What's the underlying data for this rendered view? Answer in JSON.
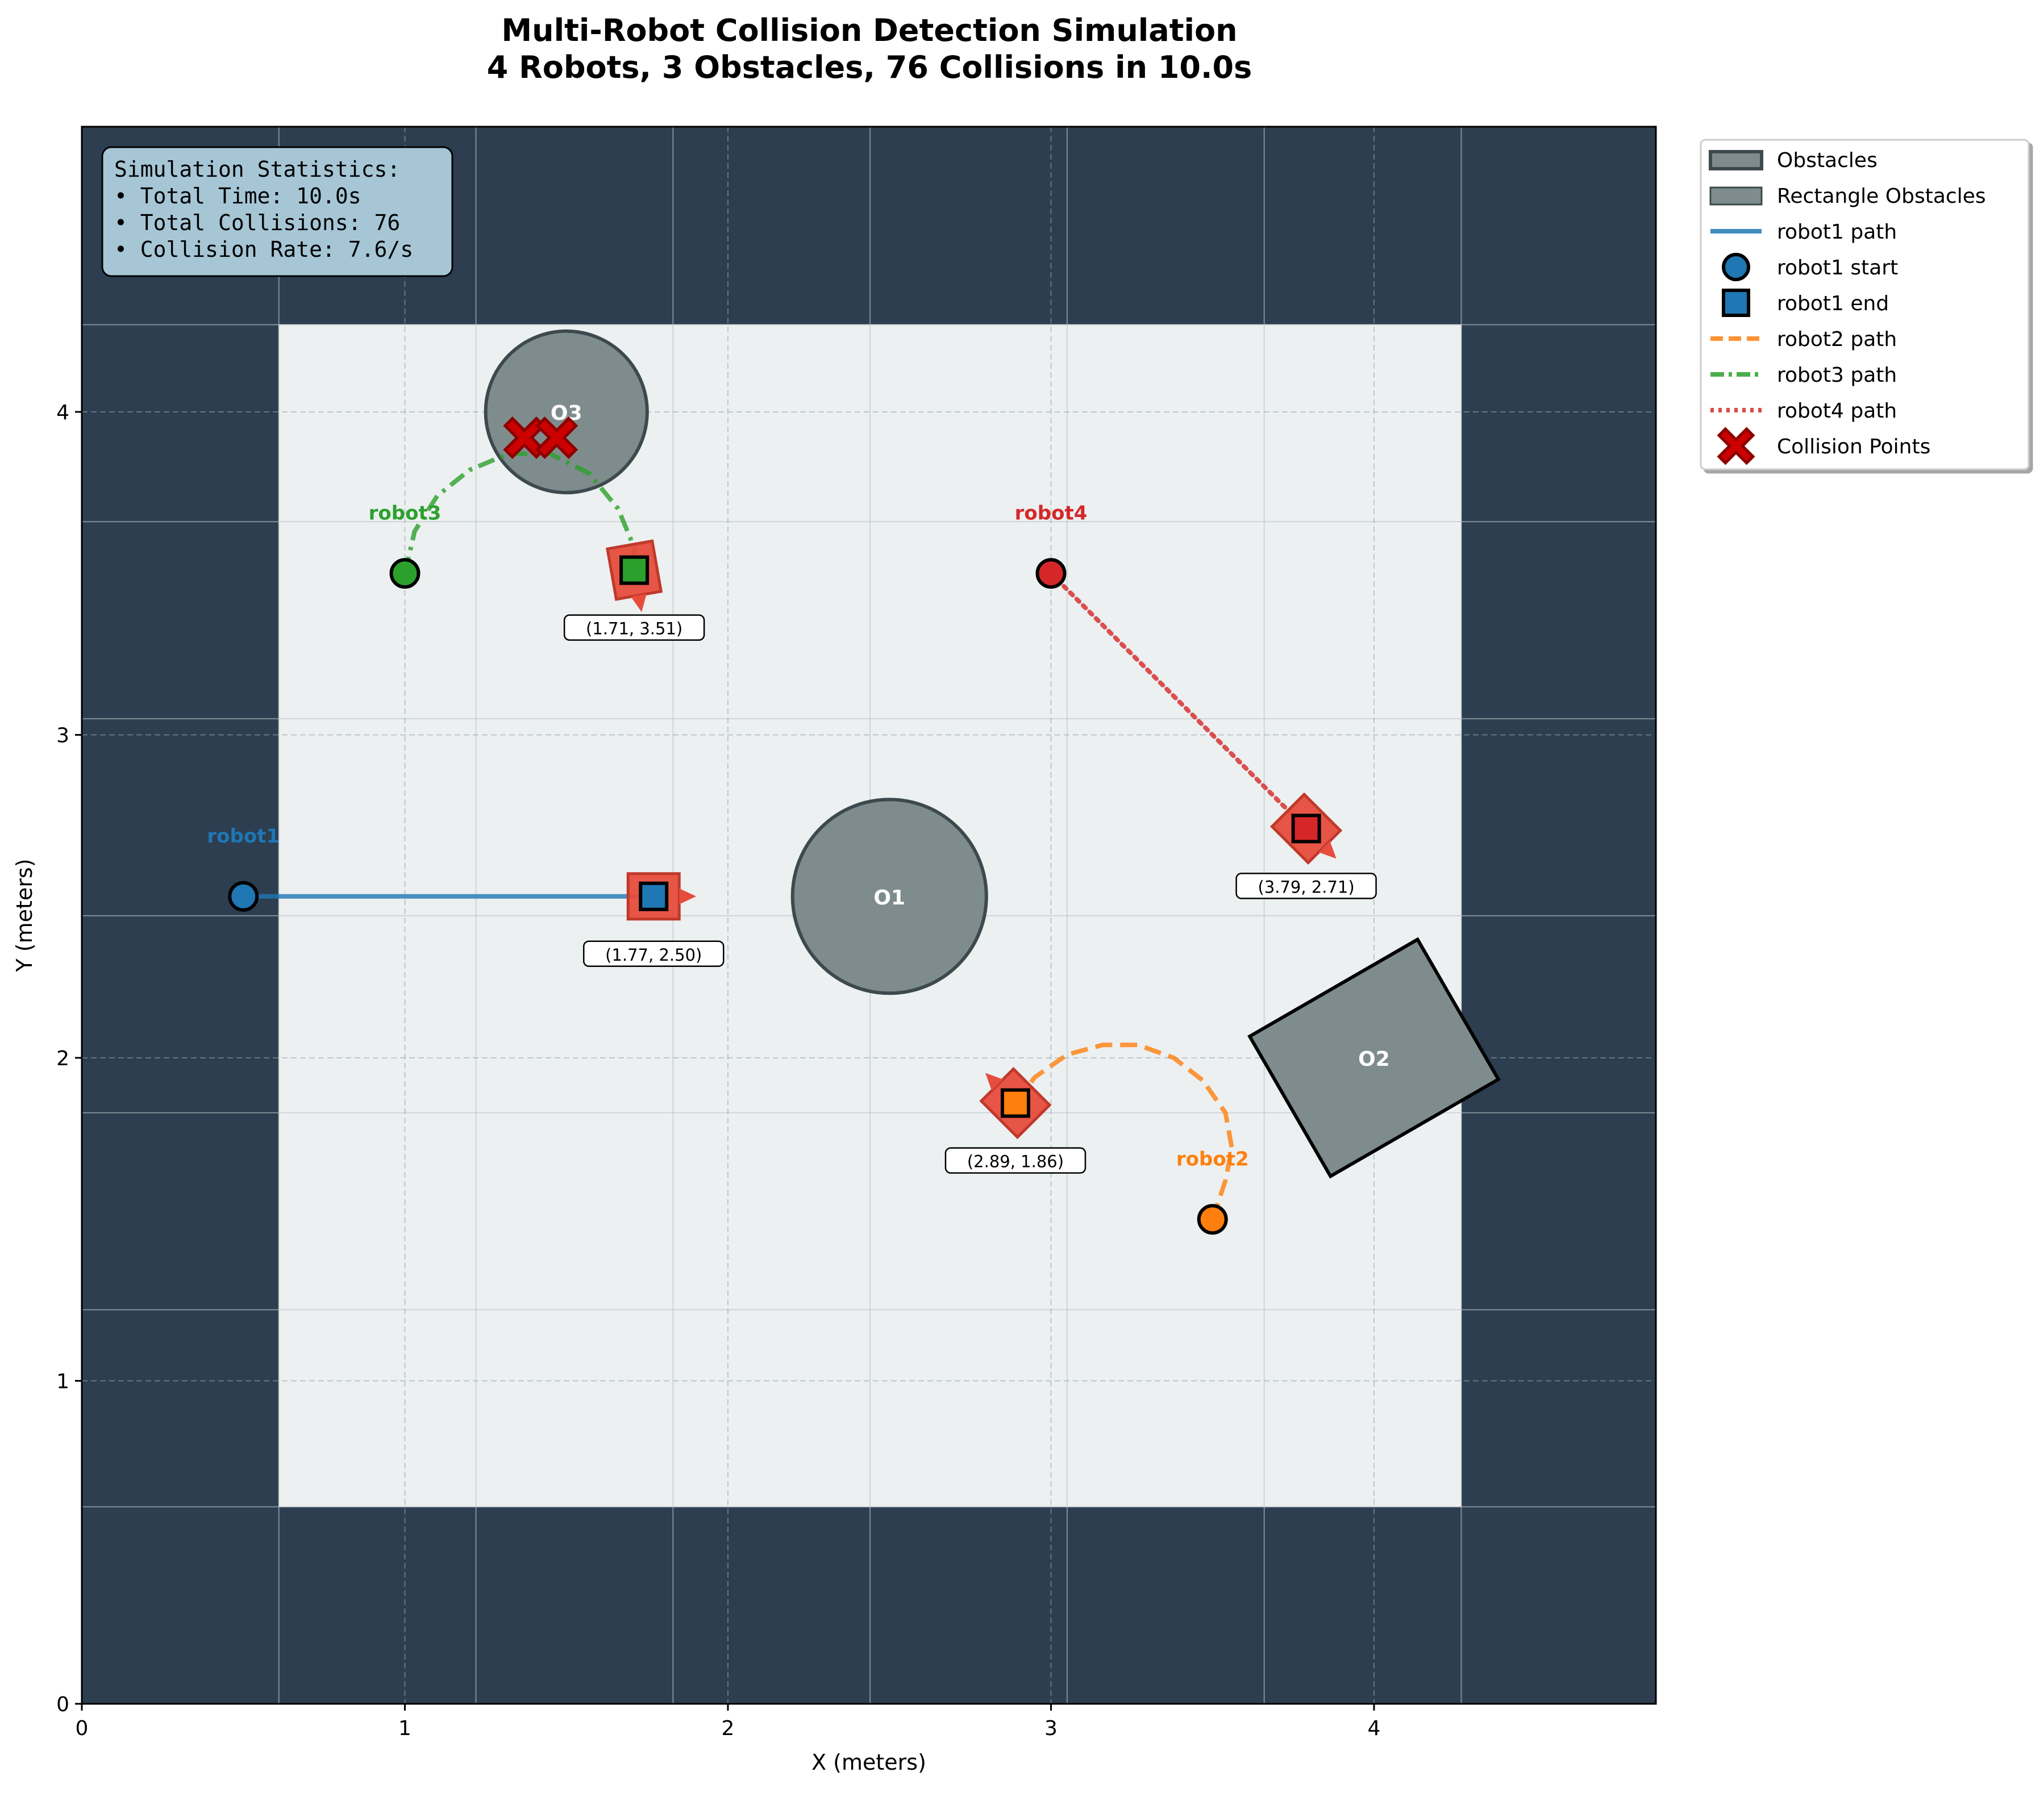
{
  "chart_data": {
    "type": "scatter",
    "title": "Multi-Robot Collision Detection Simulation",
    "subtitle": "4 Robots, 3 Obstacles, 76 Collisions in 10.0s",
    "xlabel": "X (meters)",
    "ylabel": "Y (meters)",
    "xlim": [
      0,
      4.88
    ],
    "ylim": [
      0,
      4.88
    ],
    "xticks": [
      0,
      1,
      2,
      3,
      4
    ],
    "yticks": [
      0,
      1,
      2,
      3,
      4
    ],
    "grid": true,
    "legend_position": "outside-right-top",
    "stats": {
      "header": "Simulation Statistics:",
      "lines": [
        "• Total Time: 10.0s",
        "• Total Collisions: 76",
        "• Collision Rate: 7.6/s"
      ]
    },
    "workspace": {
      "x": [
        0.61,
        4.27
      ],
      "y": [
        0.61,
        4.27
      ]
    },
    "obstacles": [
      {
        "label": "O1",
        "shape": "circle",
        "cx": 2.5,
        "cy": 2.5,
        "r": 0.3
      },
      {
        "label": "O2",
        "shape": "rectangle",
        "cx": 4.0,
        "cy": 2.0,
        "width": 0.6,
        "height": 0.5,
        "angle_deg": 30
      },
      {
        "label": "O3",
        "shape": "circle",
        "cx": 1.5,
        "cy": 4.0,
        "r": 0.25
      }
    ],
    "robots": [
      {
        "name": "robot1",
        "color": "#1f77b4",
        "start": [
          0.5,
          2.5
        ],
        "end": [
          1.77,
          2.5
        ],
        "end_label": "(1.77, 2.50)",
        "heading_deg": 0,
        "path": [
          [
            0.5,
            2.5
          ],
          [
            1.77,
            2.5
          ]
        ]
      },
      {
        "name": "robot2",
        "color": "#ff7f0e",
        "start": [
          3.5,
          1.5
        ],
        "end": [
          2.89,
          1.86
        ],
        "end_label": "(2.89, 1.86)",
        "heading_deg": 135,
        "path": [
          [
            3.5,
            1.5
          ],
          [
            3.54,
            1.62
          ],
          [
            3.56,
            1.72
          ],
          [
            3.54,
            1.83
          ],
          [
            3.47,
            1.93
          ],
          [
            3.38,
            2.0
          ],
          [
            3.27,
            2.04
          ],
          [
            3.16,
            2.04
          ],
          [
            3.05,
            2.01
          ],
          [
            2.95,
            1.94
          ],
          [
            2.89,
            1.86
          ]
        ]
      },
      {
        "name": "robot3",
        "color": "#2ca02c",
        "start": [
          1.0,
          3.5
        ],
        "end": [
          1.71,
          3.51
        ],
        "end_label": "(1.71, 3.51)",
        "heading_deg": -80,
        "path": [
          [
            1.0,
            3.5
          ],
          [
            1.03,
            3.63
          ],
          [
            1.1,
            3.74
          ],
          [
            1.2,
            3.82
          ],
          [
            1.32,
            3.87
          ],
          [
            1.45,
            3.87
          ],
          [
            1.57,
            3.81
          ],
          [
            1.66,
            3.7
          ],
          [
            1.71,
            3.58
          ],
          [
            1.71,
            3.51
          ]
        ]
      },
      {
        "name": "robot4",
        "color": "#d62728",
        "start": [
          3.0,
          3.5
        ],
        "end": [
          3.79,
          2.71
        ],
        "end_label": "(3.79, 2.71)",
        "heading_deg": -45,
        "path": [
          [
            3.0,
            3.5
          ],
          [
            3.79,
            2.71
          ]
        ]
      }
    ],
    "collision_points": [
      [
        1.37,
        3.92
      ],
      [
        1.47,
        3.92
      ]
    ],
    "legend": [
      {
        "kind": "patch-dark",
        "label": "Obstacles"
      },
      {
        "kind": "patch",
        "label": "Rectangle Obstacles"
      },
      {
        "kind": "line",
        "style": "solid",
        "color": "#1f77b4",
        "label": "robot1 path"
      },
      {
        "kind": "circle",
        "color": "#1f77b4",
        "label": "robot1 start"
      },
      {
        "kind": "square",
        "color": "#1f77b4",
        "label": "robot1 end"
      },
      {
        "kind": "line",
        "style": "dashed",
        "color": "#ff7f0e",
        "label": "robot2 path"
      },
      {
        "kind": "line",
        "style": "dashdot",
        "color": "#2ca02c",
        "label": "robot3 path"
      },
      {
        "kind": "line",
        "style": "dotted",
        "color": "#d62728",
        "label": "robot4 path"
      },
      {
        "kind": "cross",
        "color": "#cc0000",
        "label": "Collision Points"
      }
    ],
    "colors": {
      "background": "#2c3e50",
      "workspace": "#ecf0f1",
      "obstacle_fill": "#7f8c8d",
      "grid": "#bdc3c7",
      "marker_box": "#e74c3c",
      "stats_box": "#a6c6d6"
    }
  }
}
